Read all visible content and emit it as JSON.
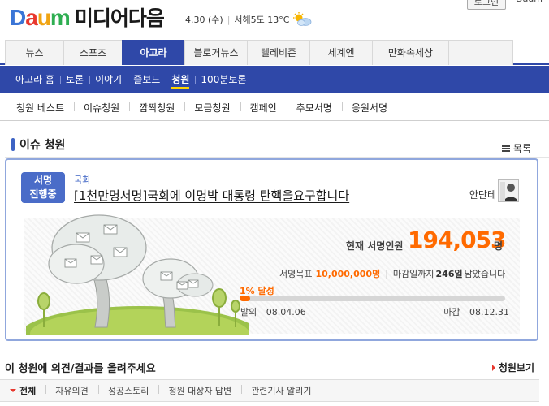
{
  "header": {
    "logo_letters": [
      "D",
      "a",
      "u",
      "m"
    ],
    "logo_colors": [
      "#3a75d6",
      "#e8382e",
      "#f0a413",
      "#2eae51"
    ],
    "site_title": "미디어다음",
    "date": "4.30 (수)",
    "weather": "서해5도 13°C",
    "weather_icon": "sun-cloud-icon",
    "login_label": "로그인",
    "daum_link": "Daum"
  },
  "main_nav": {
    "items": [
      "뉴스",
      "스포츠",
      "아고라",
      "블로거뉴스",
      "텔레비존",
      "세계엔",
      "만화속세상"
    ],
    "active_index": 2,
    "accent": "#2f48a8"
  },
  "sub_nav": {
    "items": [
      "아고라 홈",
      "토론",
      "이야기",
      "즐보드",
      "청원",
      "100분토론"
    ],
    "active_index": 4
  },
  "third_nav": {
    "items": [
      "청원 베스트",
      "이슈청원",
      "깜짝청원",
      "모금청원",
      "캠페인",
      "추모서명",
      "응원서명"
    ]
  },
  "section": {
    "title": "이슈 청원",
    "list_label": "목록"
  },
  "petition": {
    "status_line1": "서명",
    "status_line2": "진행중",
    "category": "국회",
    "title": "[1천만명서명]국회에 이명박 대통령 탄핵을요구합니다",
    "author": "안단테",
    "count_label": "현재 서명인원",
    "count": "194,053",
    "count_unit": "명",
    "goal_label": "서명목표",
    "goal": "10,000,000명",
    "deadline_prefix": "마감일까지",
    "days_left": "246일",
    "deadline_suffix": "남았습니다",
    "progress_label": "1% 달성",
    "progress_percent": 1.94,
    "start_label": "발의",
    "start_date": "08.04.06",
    "end_label": "마감",
    "end_date": "08.12.31",
    "accent": "#ff6a00"
  },
  "comments": {
    "heading": "이 청원에 의견/결과를 올려주세요",
    "view_label": "청원보기",
    "tabs": [
      "전체",
      "자유의견",
      "성공스토리",
      "청원 대상자 답변",
      "관련기사 알리기"
    ],
    "active_index": 0
  }
}
